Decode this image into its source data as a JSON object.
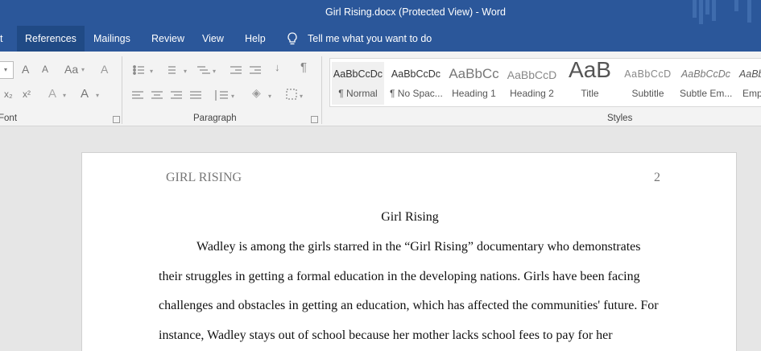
{
  "window": {
    "title": "Girl Rising.docx (Protected View)  -  Word"
  },
  "tabs": [
    {
      "label": "t",
      "active": false
    },
    {
      "label": "References",
      "active": true
    },
    {
      "label": "Mailings",
      "active": false
    },
    {
      "label": "Review",
      "active": false
    },
    {
      "label": "View",
      "active": false
    },
    {
      "label": "Help",
      "active": false
    }
  ],
  "tell_me": {
    "text": "Tell me what you want to do",
    "icon": "lightbulb-icon"
  },
  "ribbon": {
    "font_group_label": "Font",
    "paragraph_group_label": "Paragraph",
    "styles_group_label": "Styles",
    "font_buttons": {
      "grow": "A",
      "shrink": "A",
      "change_case": "Aa",
      "clear": "A",
      "subscript": "x₂",
      "superscript": "x²",
      "effects": "A",
      "color": "A"
    },
    "styles": [
      {
        "sample": "AaBbCcDc",
        "name": "¶ Normal"
      },
      {
        "sample": "AaBbCcDc",
        "name": "¶ No Spac..."
      },
      {
        "sample": "AaBbCc",
        "name": "Heading 1"
      },
      {
        "sample": "AaBbCcD",
        "name": "Heading 2"
      },
      {
        "sample": "AaB",
        "name": "Title"
      },
      {
        "sample": "AaBbCcD",
        "name": "Subtitle"
      },
      {
        "sample": "AaBbCcDc",
        "name": "Subtle Em..."
      },
      {
        "sample": "AaBbCcDc",
        "name": "Emp"
      }
    ],
    "accent_color": "#2b579a"
  },
  "document": {
    "header_left": "GIRL RISING",
    "header_right": "2",
    "title": "Girl Rising",
    "lines": [
      "Wadley is among the girls starred in the “Girl Rising” documentary who demonstrates",
      "their struggles in getting a formal education in the developing nations. Girls have been facing",
      "challenges and obstacles in getting an education, which has affected the communities' future. For",
      "instance, Wadley stays out of school because her mother lacks school fees to pay for her"
    ]
  }
}
